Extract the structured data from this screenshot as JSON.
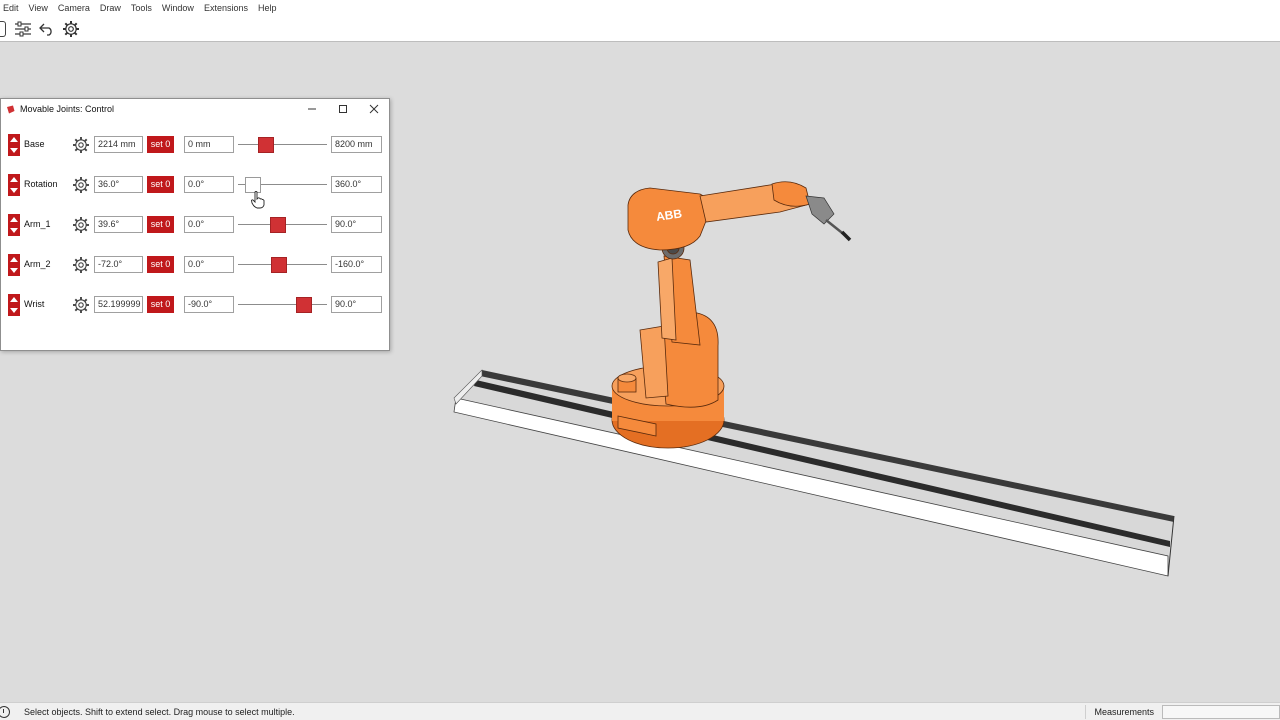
{
  "menu": [
    "Edit",
    "View",
    "Camera",
    "Draw",
    "Tools",
    "Window",
    "Extensions",
    "Help"
  ],
  "toolbar": {
    "icons": [
      "sliders-icon",
      "undo-icon",
      "gear-icon"
    ]
  },
  "dialog": {
    "title": "Movable Joints: Control",
    "set_label": "set 0",
    "joints": [
      {
        "name": "Base",
        "value": "2214 mm",
        "min": "0 mm",
        "max": "8200 mm",
        "level": 0.27,
        "active": false
      },
      {
        "name": "Rotation",
        "value": "36.0°",
        "min": "0.0°",
        "max": "360.0°",
        "level": 0.1,
        "active": true
      },
      {
        "name": "Arm_1",
        "value": "39.6°",
        "min": "0.0°",
        "max": "90.0°",
        "level": 0.44,
        "active": false
      },
      {
        "name": "Arm_2",
        "value": "-72.0°",
        "min": "0.0°",
        "max": "-160.0°",
        "level": 0.45,
        "active": false
      },
      {
        "name": "Wrist",
        "value": "52.199999",
        "min": "-90.0°",
        "max": "90.0°",
        "level": 0.79,
        "active": false
      }
    ]
  },
  "colors": {
    "accent_red": "#c0181b",
    "robot_orange": "#f58a3c",
    "viewport_bg": "#dcdcdc"
  },
  "scene": {
    "brand": "ABB"
  },
  "status": {
    "hint": "Select objects. Shift to extend select. Drag mouse to select multiple.",
    "measurements_label": "Measurements"
  }
}
